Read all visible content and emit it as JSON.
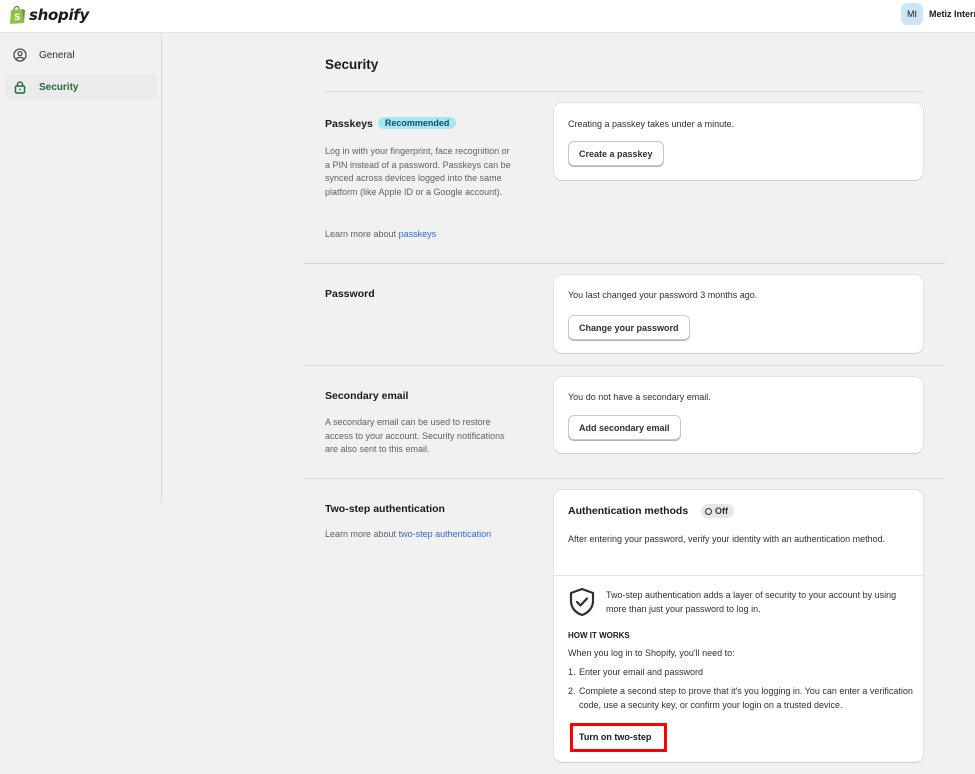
{
  "header": {
    "logo_text": "shopify",
    "avatar_initials": "MI",
    "store_name": "Metiz Interr"
  },
  "sidebar": {
    "items": [
      {
        "label": "General",
        "icon": "person-circle-icon",
        "active": false
      },
      {
        "label": "Security",
        "icon": "lock-icon",
        "active": true
      }
    ]
  },
  "page": {
    "title": "Security"
  },
  "passkeys": {
    "title": "Passkeys",
    "badge": "Recommended",
    "description": "Log in with your fingerprint, face recognition or a PIN instead of a password. Passkeys can be synced across devices logged into the same platform (like Apple ID or a Google account).",
    "learn_prefix": "Learn more about",
    "learn_link": "passkeys",
    "card_text": "Creating a passkey takes under a minute.",
    "button": "Create a passkey"
  },
  "password": {
    "title": "Password",
    "card_text": "You last changed your password 3 months ago.",
    "button": "Change your password"
  },
  "secondary_email": {
    "title": "Secondary email",
    "description": "A secondary email can be used to restore access to your account. Security notifications are also sent to this email.",
    "card_text": "You do not have a secondary email.",
    "button": "Add secondary email"
  },
  "two_step": {
    "title": "Two-step authentication",
    "learn_prefix": "Learn more about",
    "learn_link": "two-step authentication",
    "card_title": "Authentication methods",
    "status": "Off",
    "intro": "After entering your password, verify your identity with an authentication method.",
    "shield_text": "Two-step authentication adds a layer of security to your account by using more than just your password to log in.",
    "how_heading": "HOW IT WORKS",
    "how_intro": "When you log in to Shopify, you'll need to:",
    "steps": [
      {
        "num": "1.",
        "text": "Enter your email and password"
      },
      {
        "num": "2.",
        "text": "Complete a second step to prove that it's you logging in. You can enter a verification code, use a security key, or confirm your login on a trusted device."
      }
    ],
    "button": "Turn on two-step"
  },
  "colors": {
    "accent_green": "#1f6b3b",
    "link_blue": "#2c6ecb",
    "highlight_red": "#ff0000",
    "badge_cyan": "#a4e8f2"
  }
}
